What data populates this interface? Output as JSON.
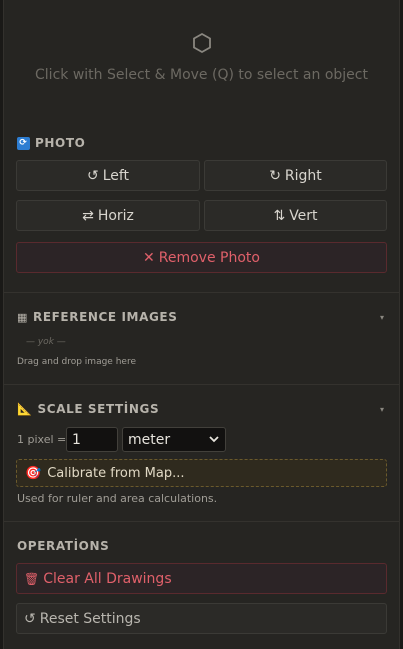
{
  "empty_state": {
    "icon": "hexagon-icon",
    "hint": "Click with Select & Move (Q) to select an object"
  },
  "photo": {
    "title": "PHOTO",
    "rotate_left": {
      "icon": "↺",
      "label": "Left"
    },
    "rotate_right": {
      "icon": "↻",
      "label": "Right"
    },
    "flip_horiz": {
      "icon": "⇄",
      "label": "Horiz"
    },
    "flip_vert": {
      "icon": "⇅",
      "label": "Vert"
    },
    "remove": {
      "icon": "✕",
      "label": "Remove Photo"
    }
  },
  "reference_images": {
    "title": "REFERENCE IMAGES",
    "caret": "▾",
    "empty": "— yok —",
    "drop_hint": "Drag and drop image here"
  },
  "scale": {
    "title": "SCALE SETTİNGS",
    "caret": "▾",
    "pixel_label": "1 pixel =",
    "value": "1",
    "unit": "meter",
    "calibrate": {
      "icon": "🎯",
      "label": "Calibrate from Map..."
    },
    "note": "Used for ruler and area calculations."
  },
  "operations": {
    "title": "OPERATİONS",
    "clear": {
      "icon": "🗑",
      "label": "Clear All Drawings"
    },
    "reset": {
      "icon": "↺",
      "label": "Reset Settings"
    }
  },
  "colors": {
    "danger": "#e0606a",
    "accent": "#2d7dd2"
  }
}
